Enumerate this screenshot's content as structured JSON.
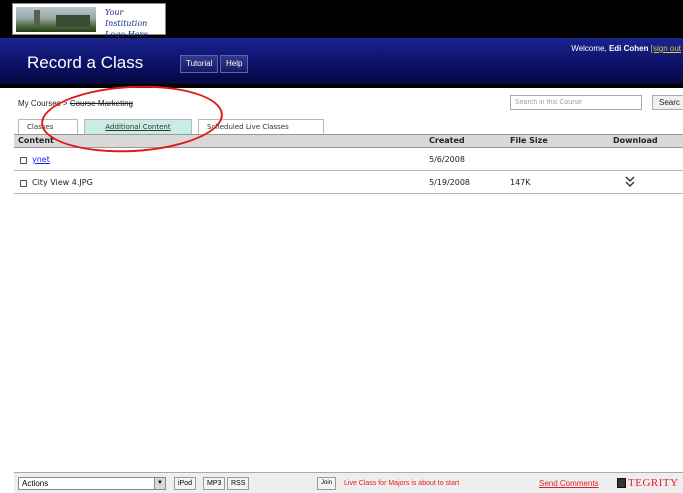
{
  "logo": {
    "text": "Your Institution\nLogo Here"
  },
  "header": {
    "app_title": "Record a Class",
    "tutorial_label": "Tutorial",
    "help_label": "Help",
    "welcome_prefix": "Welcome,",
    "user_name": "Edi Cohen",
    "signout_label": "[sign out"
  },
  "breadcrumb": {
    "root": "My Courses",
    "separator": ">",
    "course": "Course Marketing"
  },
  "search": {
    "placeholder": "Search in this Course",
    "button_label": "Searc"
  },
  "tabs": [
    {
      "label": "Classes",
      "active": false
    },
    {
      "label": "Additional Content",
      "active": true
    },
    {
      "label": "Scheduled Live Classes",
      "active": false
    }
  ],
  "table": {
    "columns": [
      "Content",
      "Created",
      "File Size",
      "Download"
    ],
    "rows": [
      {
        "name": "ynet",
        "created": "5/6/2008",
        "size": "",
        "download_icon": "download-chevrons-icon"
      },
      {
        "name": "City View 4.JPG",
        "created": "5/19/2008",
        "size": "147K",
        "download_icon": "download-chevrons-icon"
      }
    ]
  },
  "footer": {
    "actions_label": "Actions",
    "ipod_label": "iPod",
    "mp3_label": "MP3",
    "rss_label": "RSS",
    "join_label": "Join",
    "live_message": "Live Class for Majors is about to start",
    "send_comments_label": "Send Comments",
    "brand": "TEGRITY"
  },
  "colors": {
    "header_blue": "#0b1065",
    "active_tab": "#c9ece6",
    "annotation_red": "#e01919",
    "alert_red": "#e02020",
    "link_blue": "#1a1aff"
  }
}
